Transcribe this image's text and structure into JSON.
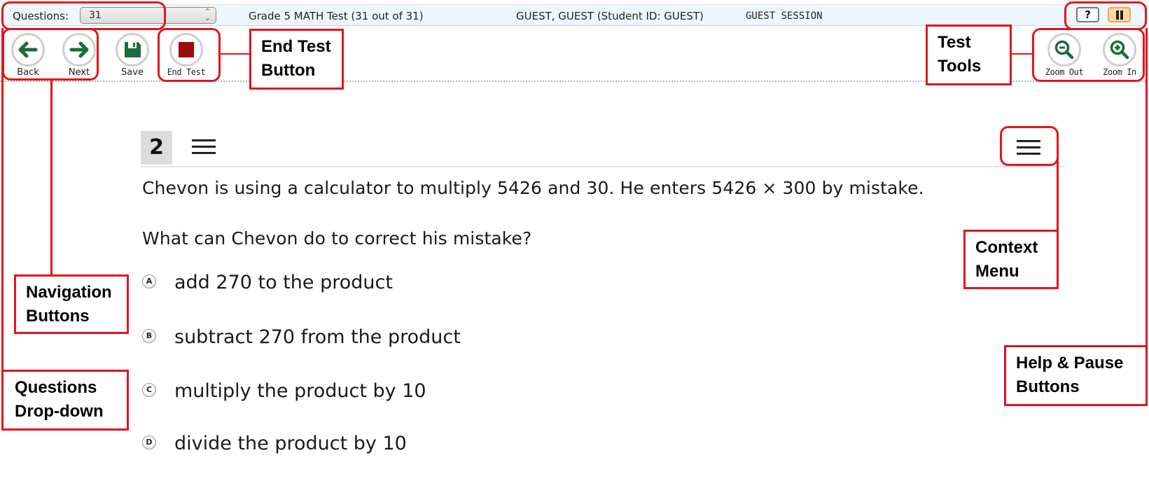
{
  "header": {
    "questions_label": "Questions:",
    "questions_selected": "31",
    "test_title": "Grade 5 MATH Test (31 out of 31)",
    "student": "GUEST, GUEST (Student ID: GUEST)",
    "session": "GUEST SESSION",
    "help_label": "?",
    "pause_icon": "pause-icon"
  },
  "toolbar": {
    "back_label": "Back",
    "next_label": "Next",
    "save_label": "Save",
    "end_test_label": "End Test",
    "zoom_out_label": "Zoom Out",
    "zoom_in_label": "Zoom In",
    "colors": {
      "nav_green": "#1b6b3c",
      "end_red": "#9b0b0f"
    }
  },
  "question": {
    "number": "2",
    "stem": "Chevon is using a calculator to multiply 5426 and 30. He enters 5426 × 300 by mistake.",
    "prompt": "What can Chevon do to correct his mistake?",
    "options": [
      {
        "letter": "A",
        "text": "add 270 to the product"
      },
      {
        "letter": "B",
        "text": "subtract 270 from the product"
      },
      {
        "letter": "C",
        "text": "multiply the product by 10"
      },
      {
        "letter": "D",
        "text": "divide the product by 10"
      }
    ]
  },
  "annotations": {
    "end_test": [
      "End Test",
      "Button"
    ],
    "test_tools": [
      "Test",
      "Tools"
    ],
    "navigation": [
      "Navigation",
      "Buttons"
    ],
    "questions_dropdown": [
      "Questions",
      "Drop-down"
    ],
    "context_menu": [
      "Context",
      "Menu"
    ],
    "help_pause": [
      "Help & Pause",
      "Buttons"
    ],
    "color": "#e3141b"
  }
}
